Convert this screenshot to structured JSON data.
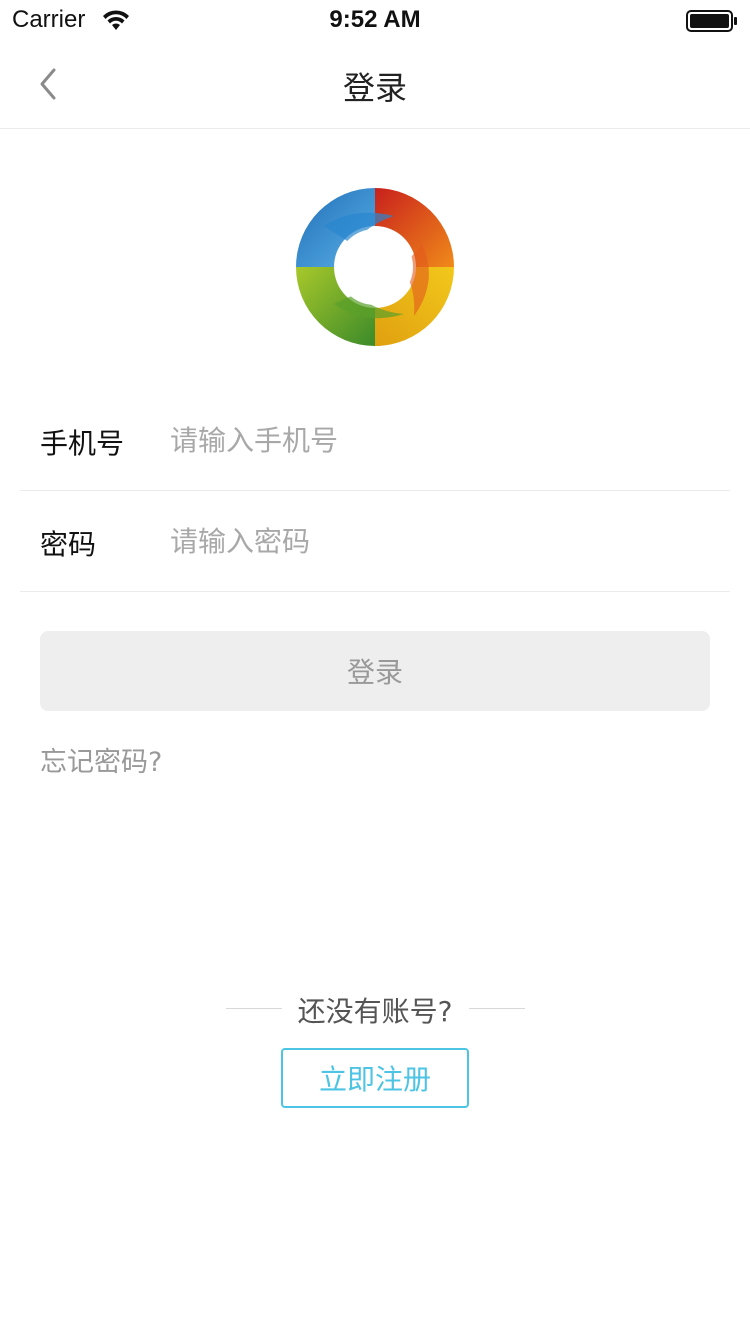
{
  "status_bar": {
    "carrier": "Carrier",
    "time": "9:52 AM",
    "wifi_icon": "wifi-icon",
    "battery_icon": "battery-icon"
  },
  "nav": {
    "title": "登录",
    "back_icon": "chevron-left-icon"
  },
  "logo": {
    "icon": "app-logo-ring"
  },
  "form": {
    "phone_label": "手机号",
    "phone_placeholder": "请输入手机号",
    "phone_value": "",
    "password_label": "密码",
    "password_placeholder": "请输入密码",
    "password_value": ""
  },
  "login_button_label": "登录",
  "forgot_password_label": "忘记密码?",
  "register": {
    "prompt": "还没有账号?",
    "button_label": "立即注册"
  },
  "colors": {
    "accent": "#4ec4e4",
    "disabled_button_bg": "#eeeeee",
    "placeholder": "#a8a8a8"
  }
}
